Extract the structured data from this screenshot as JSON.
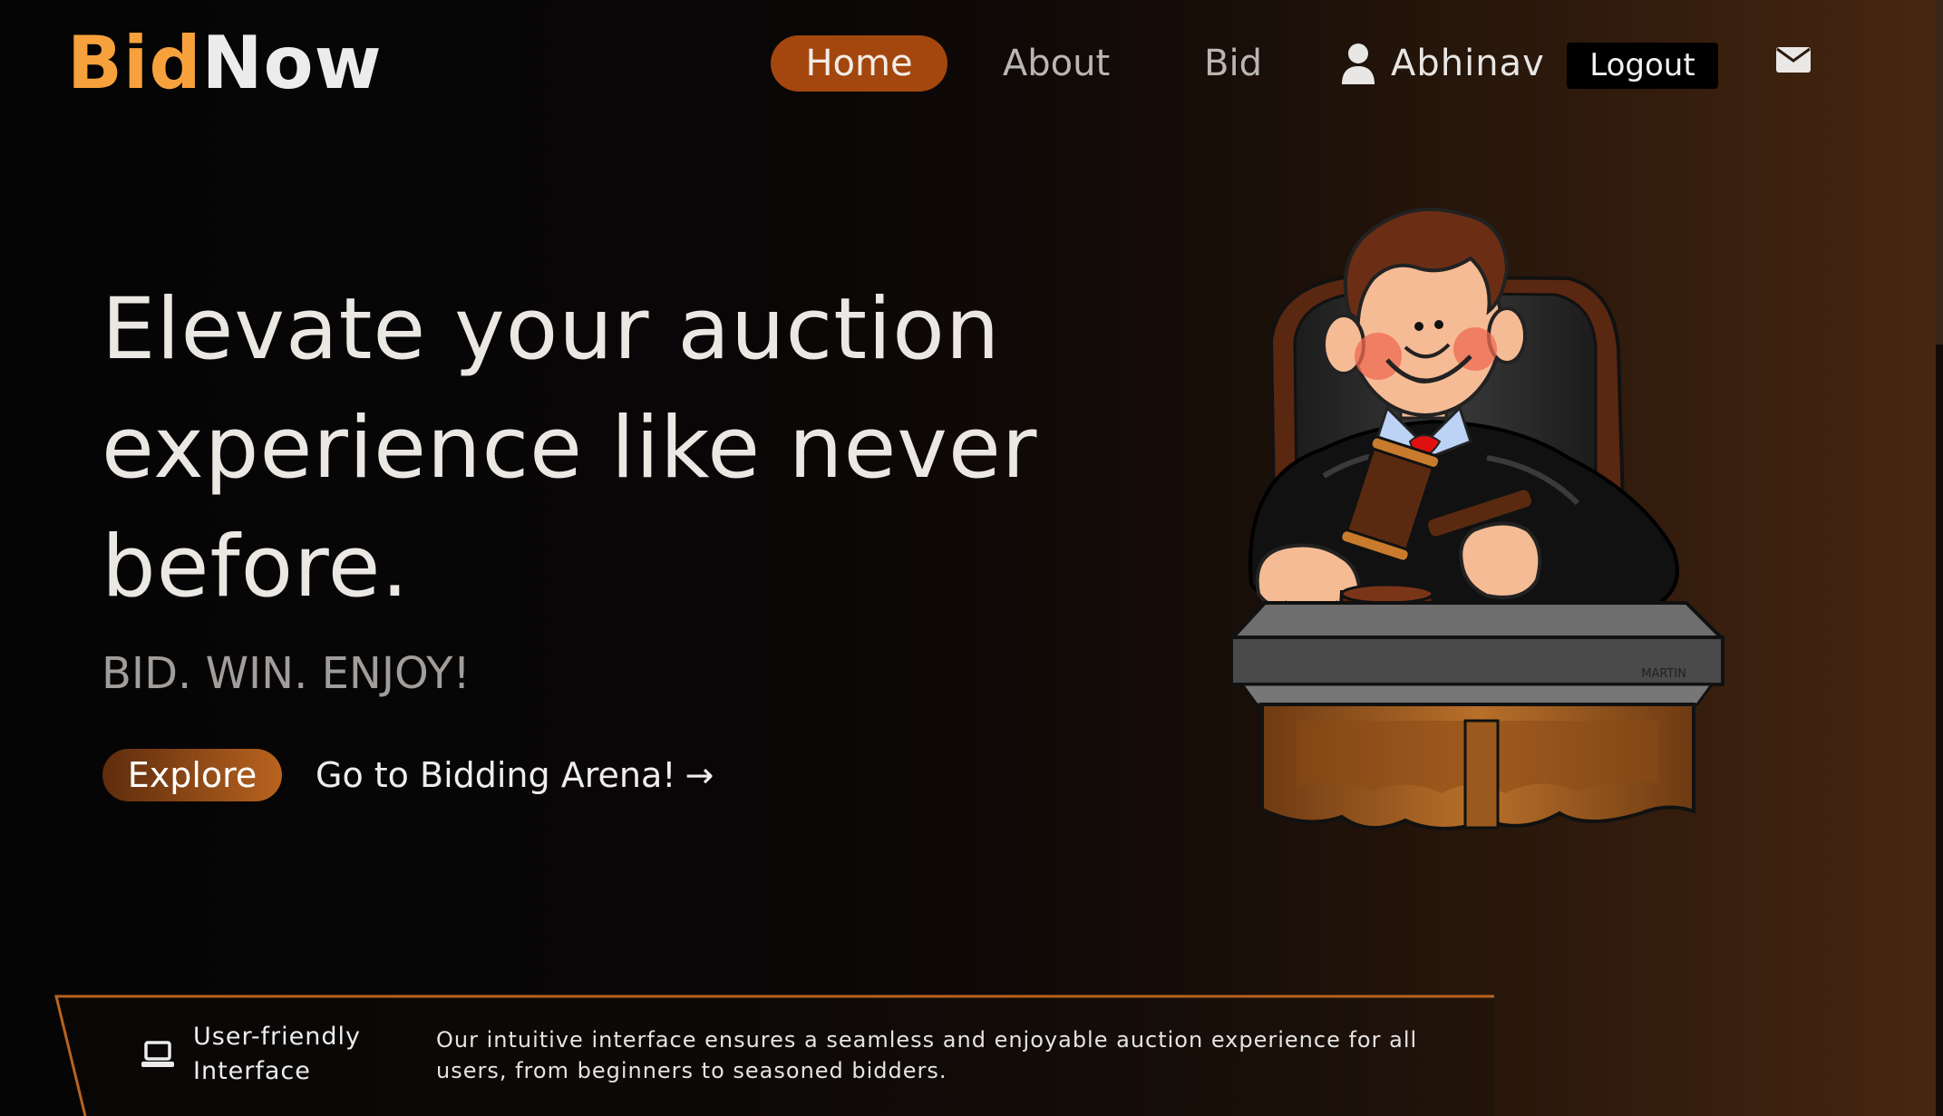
{
  "brand": {
    "part1": "Bid",
    "part2": "Now",
    "color_accent": "#f7a13d"
  },
  "nav": {
    "home": "Home",
    "about": "About",
    "bid": "Bid",
    "active": "Home",
    "active_color": "#a3470f"
  },
  "user": {
    "name": "Abhinav",
    "icon": "user-icon"
  },
  "logout_label": "Logout",
  "mail_icon": "envelope-icon",
  "hero": {
    "title": "Elevate your auction experience like never before.",
    "tagline": "BID. WIN. ENJOY!",
    "explore_label": "Explore",
    "arena_label": "Go to Bidding Arena!",
    "arena_icon": "arrow-right-icon"
  },
  "illustration": {
    "signature": "MARTIN"
  },
  "feature": {
    "icon": "laptop-icon",
    "title": "User-friendly Interface",
    "description": "Our intuitive interface ensures a seamless and enjoyable auction experience for all users, from beginners to seasoned bidders."
  }
}
